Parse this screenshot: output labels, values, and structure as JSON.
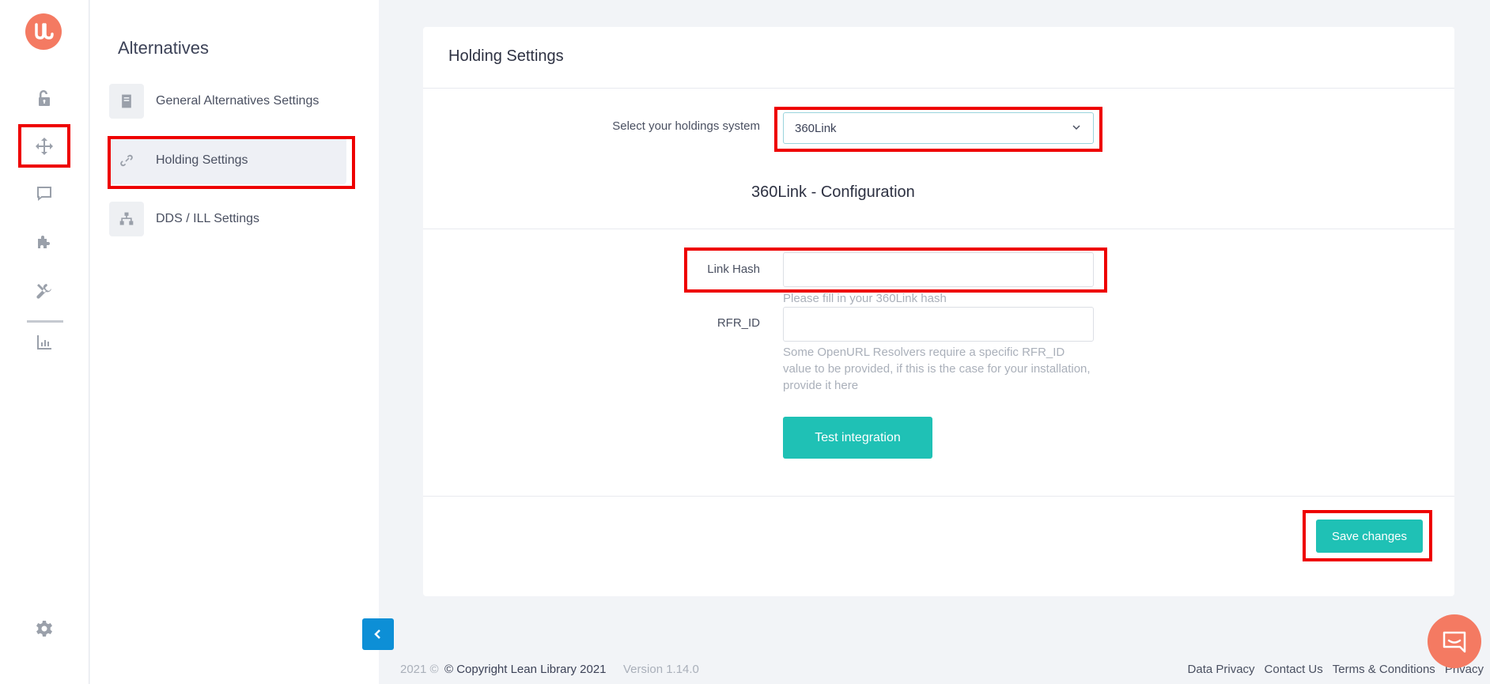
{
  "subnav": {
    "title": "Alternatives",
    "items": [
      {
        "label": "General Alternatives Settings",
        "icon": "book-icon"
      },
      {
        "label": "Holding Settings",
        "icon": "link-icon"
      },
      {
        "label": "DDS / ILL Settings",
        "icon": "sitemap-icon"
      }
    ]
  },
  "card": {
    "title": "Holding Settings",
    "holdings_label": "Select your holdings system",
    "holdings_value": "360Link",
    "config_title": "360Link - Configuration",
    "link_hash_label": "Link Hash",
    "link_hash_value": "",
    "link_hash_hint": "Please fill in your 360Link hash",
    "rfr_label": "RFR_ID",
    "rfr_value": "",
    "rfr_hint": "Some OpenURL Resolvers require a specific RFR_ID value to be provided, if this is the case for your installation, provide it here",
    "test_button": "Test integration",
    "save_button": "Save changes"
  },
  "footer": {
    "year": "2021 ©",
    "copyright": "© Copyright Lean Library 2021",
    "version": "Version 1.14.0",
    "links": [
      "Data Privacy",
      "Contact Us",
      "Terms & Conditions",
      "Privacy"
    ]
  },
  "colors": {
    "accent": "#1fc1b5",
    "brand": "#f47a62",
    "highlight": "#ee0000",
    "collapse": "#0d8fd6"
  }
}
